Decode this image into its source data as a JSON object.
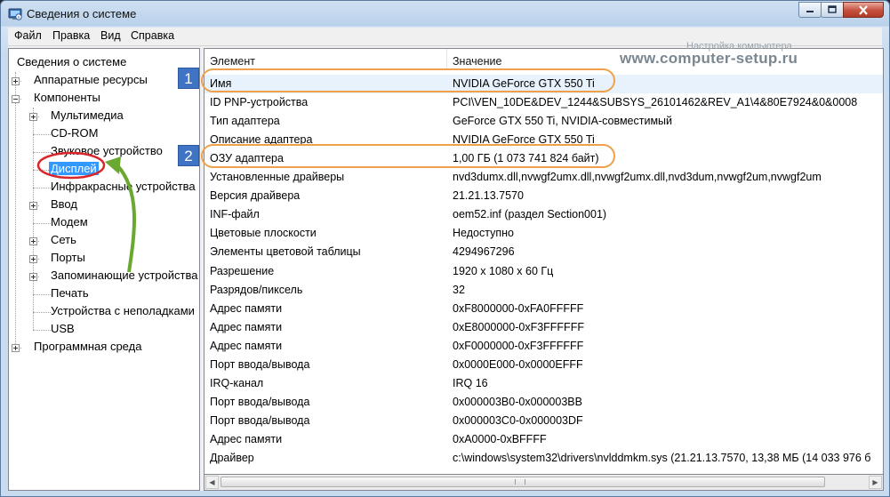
{
  "window": {
    "title": "Сведения о системе",
    "buttons": [
      "minimize",
      "maximize",
      "close"
    ]
  },
  "menu": [
    "Файл",
    "Правка",
    "Вид",
    "Справка"
  ],
  "watermark": {
    "line1": "Настройка компьютера",
    "line2": "www.computer-setup.ru"
  },
  "tree": {
    "root": "Сведения о системе",
    "hardware": "Аппаратные ресурсы",
    "components": "Компоненты",
    "children": [
      "Мультимедиа",
      "CD-ROM",
      "Звуковое устройство",
      "Дисплей",
      "Инфракрасные устройства",
      "Ввод",
      "Модем",
      "Сеть",
      "Порты",
      "Запоминающие устройства",
      "Печать",
      "Устройства с неполадками",
      "USB"
    ],
    "software": "Программная среда",
    "selected": "Дисплей"
  },
  "list": {
    "headers": [
      "Элемент",
      "Значение"
    ],
    "rows": [
      [
        "Имя",
        "NVIDIA GeForce GTX 550 Ti"
      ],
      [
        "ID PNP-устройства",
        "PCI\\VEN_10DE&DEV_1244&SUBSYS_26101462&REV_A1\\4&80E7924&0&0008"
      ],
      [
        "Тип адаптера",
        "GeForce GTX 550 Ti, NVIDIA-совместимый"
      ],
      [
        "Описание адаптера",
        "NVIDIA GeForce GTX 550 Ti"
      ],
      [
        "ОЗУ адаптера",
        "1,00 ГБ (1 073 741 824 байт)"
      ],
      [
        "Установленные драйверы",
        "nvd3dumx.dll,nvwgf2umx.dll,nvwgf2umx.dll,nvd3dum,nvwgf2um,nvwgf2um"
      ],
      [
        "Версия драйвера",
        "21.21.13.7570"
      ],
      [
        "INF-файл",
        "oem52.inf (раздел Section001)"
      ],
      [
        "Цветовые плоскости",
        "Недоступно"
      ],
      [
        "Элементы цветовой таблицы",
        "4294967296"
      ],
      [
        "Разрешение",
        "1920 x 1080 x 60 Гц"
      ],
      [
        "Разрядов/пиксель",
        "32"
      ],
      [
        "Адрес памяти",
        "0xF8000000-0xFA0FFFFF"
      ],
      [
        "Адрес памяти",
        "0xE8000000-0xF3FFFFFF"
      ],
      [
        "Адрес памяти",
        "0xF0000000-0xF3FFFFFF"
      ],
      [
        "Порт ввода/вывода",
        "0x0000E000-0x0000EFFF"
      ],
      [
        "IRQ-канал",
        "IRQ 16"
      ],
      [
        "Порт ввода/вывода",
        "0x000003B0-0x000003BB"
      ],
      [
        "Порт ввода/вывода",
        "0x000003C0-0x000003DF"
      ],
      [
        "Адрес памяти",
        "0xA0000-0xBFFFF"
      ],
      [
        "Драйвер",
        "c:\\windows\\system32\\drivers\\nvlddmkm.sys (21.21.13.7570, 13,38 МБ (14 033 976 б"
      ]
    ]
  },
  "annotations": {
    "badges": [
      "1",
      "2"
    ],
    "callout_color": "#f0a04a",
    "badge_color": "#3f73c4",
    "circle_color": "#d9262b",
    "arrow_color": "#6aa832"
  }
}
